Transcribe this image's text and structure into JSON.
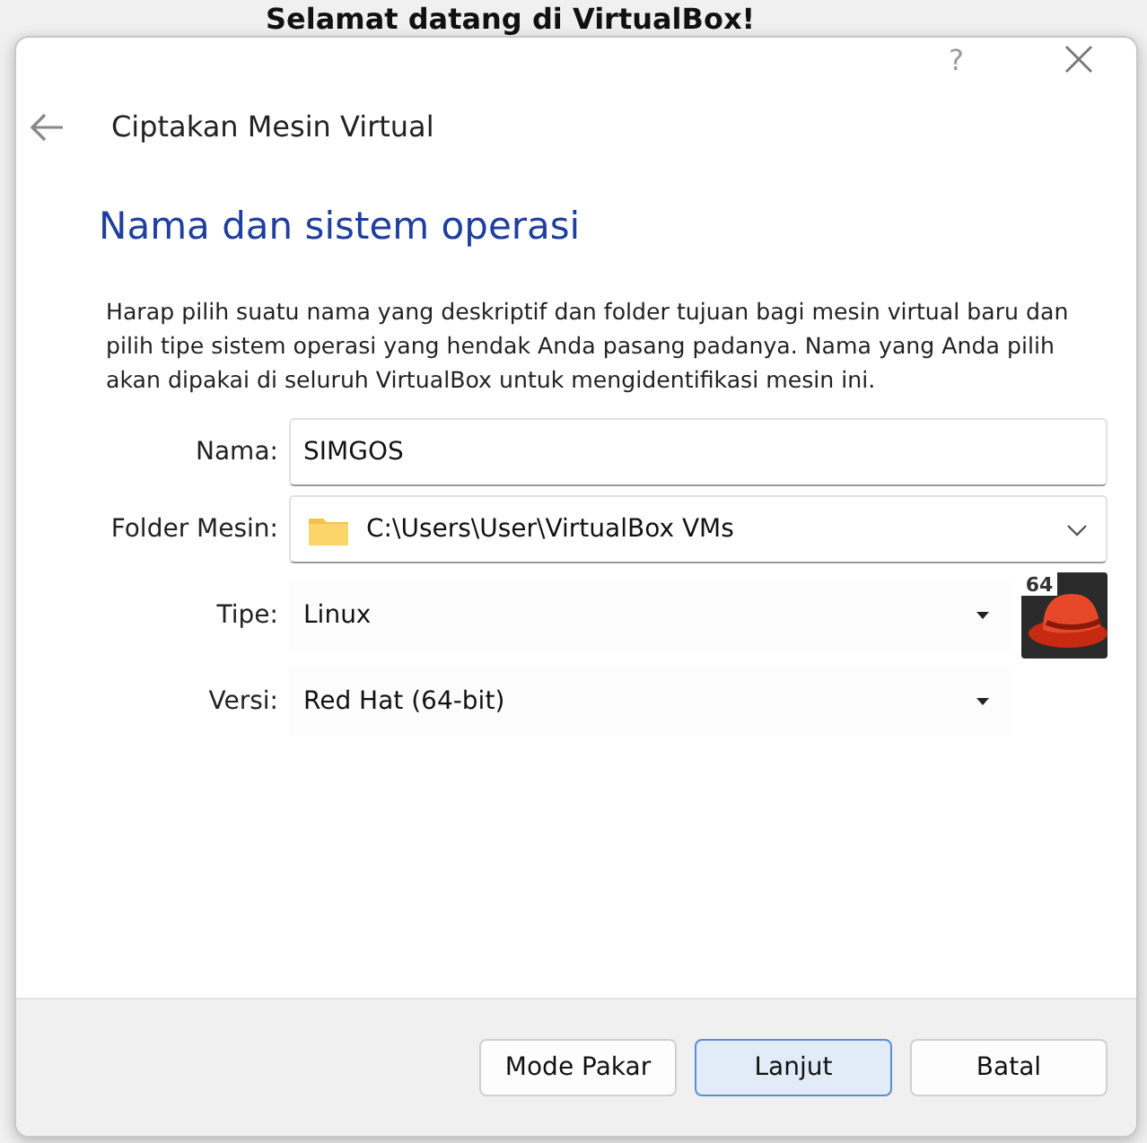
{
  "background_window": {
    "heading": "Selamat datang di VirtualBox!"
  },
  "dialog": {
    "help": "?",
    "title": "Ciptakan Mesin Virtual",
    "heading": "Nama dan sistem operasi",
    "description": "Harap pilih suatu nama yang deskriptif dan folder tujuan bagi mesin virtual baru dan pilih tipe sistem operasi yang hendak Anda pasang padanya. Nama yang Anda pilih akan dipakai di seluruh VirtualBox untuk mengidentifikasi mesin ini.",
    "fields": [
      {
        "kind": "text",
        "label": "Nama:",
        "value": "SIMGOS"
      },
      {
        "kind": "folder",
        "label": "Folder Mesin:",
        "value": "C:\\Users\\User\\VirtualBox VMs"
      },
      {
        "kind": "combo",
        "label": "Tipe:",
        "value": "Linux"
      },
      {
        "kind": "combo",
        "label": "Versi:",
        "value": "Red Hat (64-bit)"
      }
    ],
    "os_badge": "64",
    "buttons": [
      {
        "label": "Mode Pakar",
        "default": false
      },
      {
        "label": "Lanjut",
        "default": true
      },
      {
        "label": "Batal",
        "default": false
      }
    ]
  }
}
